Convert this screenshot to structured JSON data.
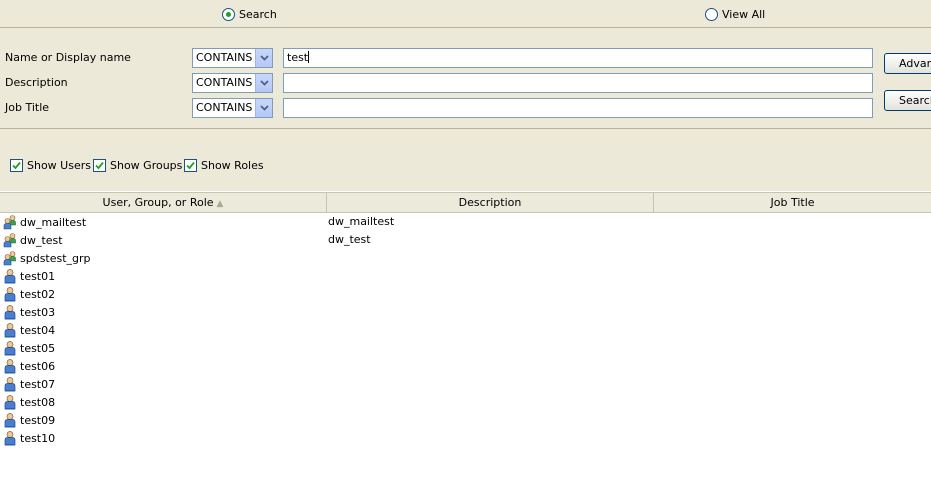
{
  "mode": {
    "search_label": "Search",
    "viewall_label": "View All",
    "selected": "search"
  },
  "filters": [
    {
      "label": "Name or Display name",
      "operator": "CONTAINS",
      "value": "test"
    },
    {
      "label": "Description",
      "operator": "CONTAINS",
      "value": ""
    },
    {
      "label": "Job Title",
      "operator": "CONTAINS",
      "value": ""
    }
  ],
  "buttons": {
    "advanced_label": "Advanced...",
    "search_label": "Search"
  },
  "show": {
    "users_label": "Show Users",
    "users_checked": true,
    "groups_label": "Show Groups",
    "groups_checked": true,
    "roles_label": "Show Roles",
    "roles_checked": true
  },
  "grid": {
    "columns": [
      {
        "label": "User, Group, or Role",
        "sorted": "ascending"
      },
      {
        "label": "Description"
      },
      {
        "label": "Job Title"
      }
    ],
    "rows": [
      {
        "icon": "group-icon",
        "name": "dw_mailtest",
        "description": "dw_mailtest",
        "job_title": ""
      },
      {
        "icon": "group-icon",
        "name": "dw_test",
        "description": "dw_test",
        "job_title": ""
      },
      {
        "icon": "group-icon",
        "name": "spdstest_grp",
        "description": "",
        "job_title": ""
      },
      {
        "icon": "user-icon",
        "name": "test01",
        "description": "",
        "job_title": ""
      },
      {
        "icon": "user-icon",
        "name": "test02",
        "description": "",
        "job_title": ""
      },
      {
        "icon": "user-icon",
        "name": "test03",
        "description": "",
        "job_title": ""
      },
      {
        "icon": "user-icon",
        "name": "test04",
        "description": "",
        "job_title": ""
      },
      {
        "icon": "user-icon",
        "name": "test05",
        "description": "",
        "job_title": ""
      },
      {
        "icon": "user-icon",
        "name": "test06",
        "description": "",
        "job_title": ""
      },
      {
        "icon": "user-icon",
        "name": "test07",
        "description": "",
        "job_title": ""
      },
      {
        "icon": "user-icon",
        "name": "test08",
        "description": "",
        "job_title": ""
      },
      {
        "icon": "user-icon",
        "name": "test09",
        "description": "",
        "job_title": ""
      },
      {
        "icon": "user-icon",
        "name": "test10",
        "description": "",
        "job_title": ""
      }
    ]
  }
}
